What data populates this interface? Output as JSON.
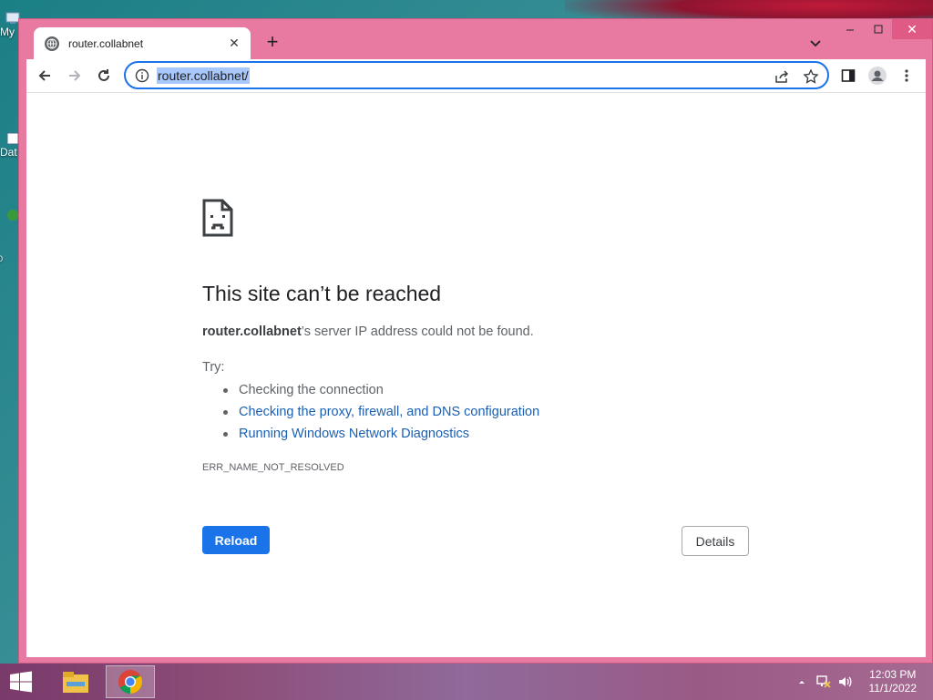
{
  "desktop": {
    "icons": [
      {
        "label": "My",
        "icon": "computer-icon"
      },
      {
        "label": "Dat",
        "icon": "data-icon"
      },
      {
        "label": "0",
        "icon": "app-icon"
      }
    ]
  },
  "browser": {
    "tab": {
      "title": "router.collabnet",
      "favicon": "globe-icon"
    },
    "window_controls": [
      "minimize-icon",
      "maximize-icon",
      "close-icon"
    ],
    "toolbar": {
      "url": "router.collabnet/",
      "icons": [
        "back-arrow-icon",
        "forward-arrow-icon",
        "reload-icon",
        "info-icon",
        "share-icon",
        "bookmark-star-icon",
        "side-panel-icon",
        "profile-icon",
        "menu-icon"
      ]
    },
    "error_page": {
      "icon": "sad-page-icon",
      "heading": "This site can’t be reached",
      "summary_host": "router.collabnet",
      "summary_rest": "’s server IP address could not be found.",
      "try_label": "Try:",
      "suggestions": [
        {
          "text": "Checking the connection",
          "link": false
        },
        {
          "text": "Checking the proxy, firewall, and DNS configuration",
          "link": true
        },
        {
          "text": "Running Windows Network Diagnostics",
          "link": true
        }
      ],
      "error_code": "ERR_NAME_NOT_RESOLVED",
      "reload_label": "Reload",
      "details_label": "Details"
    }
  },
  "taskbar": {
    "apps": [
      "file-explorer-icon",
      "chrome-icon"
    ],
    "tray_icons": [
      "up-arrow-icon",
      "network-icon",
      "volume-icon"
    ],
    "time": "12:03 PM",
    "date": "11/1/2022"
  },
  "colors": {
    "window_frame": "#e87aa2",
    "accent": "#1a73e8",
    "link": "#1a5fb4"
  }
}
